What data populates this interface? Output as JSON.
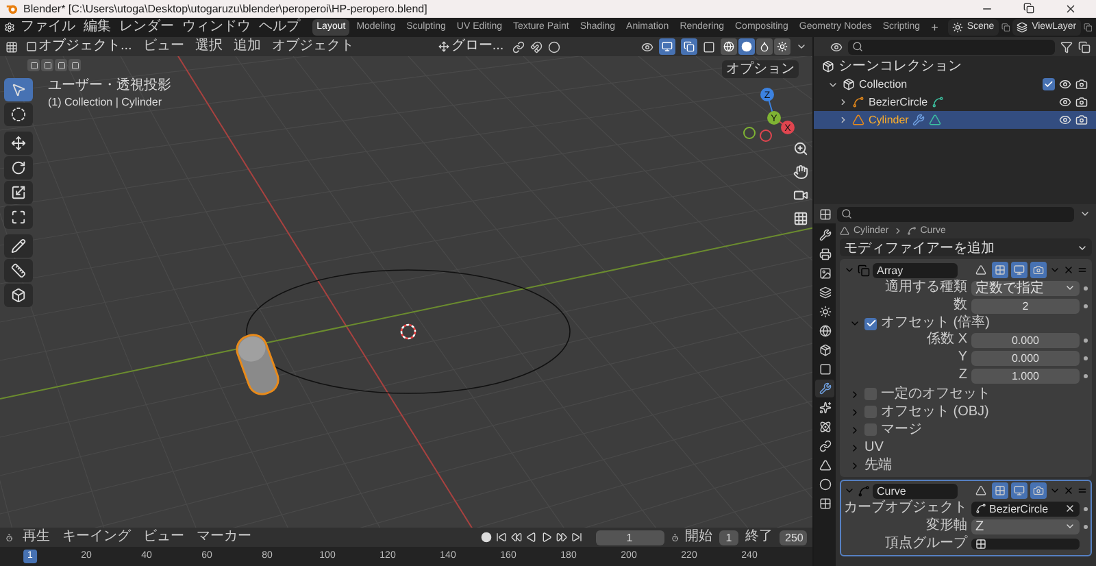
{
  "window": {
    "title": "Blender* [C:\\Users\\utoga\\Desktop\\utogaruzu\\blender\\peroperoi\\HP-peropero.blend]"
  },
  "menu": [
    "ファイル",
    "編集",
    "レンダー",
    "ウィンドウ",
    "ヘルプ"
  ],
  "workspaces": [
    {
      "label": "Layout",
      "selected": true
    },
    {
      "label": "Modeling",
      "selected": false
    },
    {
      "label": "Sculpting",
      "selected": false
    },
    {
      "label": "UV Editing",
      "selected": false
    },
    {
      "label": "Texture Paint",
      "selected": false
    },
    {
      "label": "Shading",
      "selected": false
    },
    {
      "label": "Animation",
      "selected": false
    },
    {
      "label": "Rendering",
      "selected": false
    },
    {
      "label": "Compositing",
      "selected": false
    },
    {
      "label": "Geometry Nodes",
      "selected": false
    },
    {
      "label": "Scripting",
      "selected": false
    }
  ],
  "add_workspace": "+",
  "scene": "Scene",
  "view_layer": "ViewLayer",
  "viewport": {
    "mode": "オブジェクト...",
    "menus": [
      "ビュー",
      "選択",
      "追加",
      "オブジェクト"
    ],
    "orientation": "グロー...",
    "toggles": [
      {
        "on": true
      },
      {
        "on": true
      }
    ],
    "shading": [
      {
        "selected": false
      },
      {
        "selected": true
      },
      {
        "selected": false
      },
      {
        "selected": false
      }
    ],
    "options": "オプション",
    "view_name": "ユーザー・透視投影",
    "context": "(1) Collection | Cylinder",
    "gizmo_axes": [
      "X",
      "Y",
      "Z"
    ],
    "tools": [
      {
        "selected": true
      },
      {
        "selected": false
      },
      {
        "selected": false
      },
      {
        "selected": false
      },
      {
        "selected": false
      },
      {
        "selected": false
      },
      {
        "selected": false
      },
      {
        "selected": false
      },
      {
        "selected": false
      }
    ]
  },
  "outliner": {
    "root": "シーンコレクション",
    "collections": [
      {
        "label": "Collection",
        "checked": true,
        "expanded": true,
        "children": [
          {
            "label": "BezierCircle",
            "kind": "curve",
            "selected": false
          },
          {
            "label": "Cylinder",
            "kind": "mesh",
            "selected": true
          }
        ]
      }
    ]
  },
  "properties": {
    "tabs": [
      {
        "selected": false
      },
      {
        "selected": false
      },
      {
        "selected": false
      },
      {
        "selected": false
      },
      {
        "selected": false
      },
      {
        "selected": false
      },
      {
        "selected": false
      },
      {
        "selected": false
      },
      {
        "selected": true
      },
      {
        "selected": false
      },
      {
        "selected": false
      },
      {
        "selected": false
      },
      {
        "selected": false
      },
      {
        "selected": false
      },
      {
        "selected": false
      }
    ],
    "breadcrumb": [
      "Cylinder",
      "Curve"
    ],
    "add_modifier": "モディファイアーを追加",
    "modifiers": [
      {
        "name": "Array",
        "kind": "array",
        "expanded": true,
        "toggles": [
          {
            "on": false
          },
          {
            "on": true
          },
          {
            "on": true
          },
          {
            "on": true
          }
        ],
        "rows": [
          {
            "kind": "dropdown",
            "label": "適用する種類",
            "value": "定数で指定"
          },
          {
            "kind": "number",
            "label": "数",
            "value": "2"
          }
        ],
        "offset": {
          "label": "オフセット (倍率)",
          "checked": true,
          "expanded": true,
          "rows": [
            {
              "kind": "number",
              "label": "係数 X",
              "value": "0.000"
            },
            {
              "kind": "number",
              "label": "Y",
              "value": "0.000"
            },
            {
              "kind": "number",
              "label": "Z",
              "value": "1.000"
            }
          ]
        },
        "subpanels": [
          {
            "kind": "checkbox",
            "label": "一定のオフセット",
            "checked": false
          },
          {
            "kind": "checkbox",
            "label": "オフセット (OBJ)",
            "checked": false
          },
          {
            "kind": "checkbox",
            "label": "マージ",
            "checked": false
          },
          {
            "kind": "plain",
            "label": "UV"
          },
          {
            "kind": "plain",
            "label": "先端"
          }
        ]
      },
      {
        "name": "Curve",
        "kind": "curve",
        "expanded": true,
        "toggles": [
          {
            "on": false
          },
          {
            "on": true
          },
          {
            "on": true
          },
          {
            "on": true
          }
        ],
        "rows": [
          {
            "kind": "object",
            "label": "カーブオブジェクト",
            "value": "BezierCircle"
          },
          {
            "kind": "dropdown",
            "label": "変形軸",
            "value": "Z"
          },
          {
            "kind": "group",
            "label": "頂点グループ"
          }
        ]
      }
    ]
  },
  "timeline": {
    "menus": [
      "再生",
      "キーイング",
      "ビュー",
      "マーカー"
    ],
    "current_frame": "1",
    "start": {
      "label": "開始",
      "value": "1"
    },
    "end": {
      "label": "終了",
      "value": "250"
    },
    "ticks": [
      {
        "label": "1",
        "selected": true
      },
      {
        "label": "20",
        "selected": false
      },
      {
        "label": "40",
        "selected": false
      },
      {
        "label": "60",
        "selected": false
      },
      {
        "label": "80",
        "selected": false
      },
      {
        "label": "100",
        "selected": false
      },
      {
        "label": "120",
        "selected": false
      },
      {
        "label": "140",
        "selected": false
      },
      {
        "label": "160",
        "selected": false
      },
      {
        "label": "180",
        "selected": false
      },
      {
        "label": "200",
        "selected": false
      },
      {
        "label": "220",
        "selected": false
      },
      {
        "label": "240",
        "selected": false
      }
    ]
  }
}
